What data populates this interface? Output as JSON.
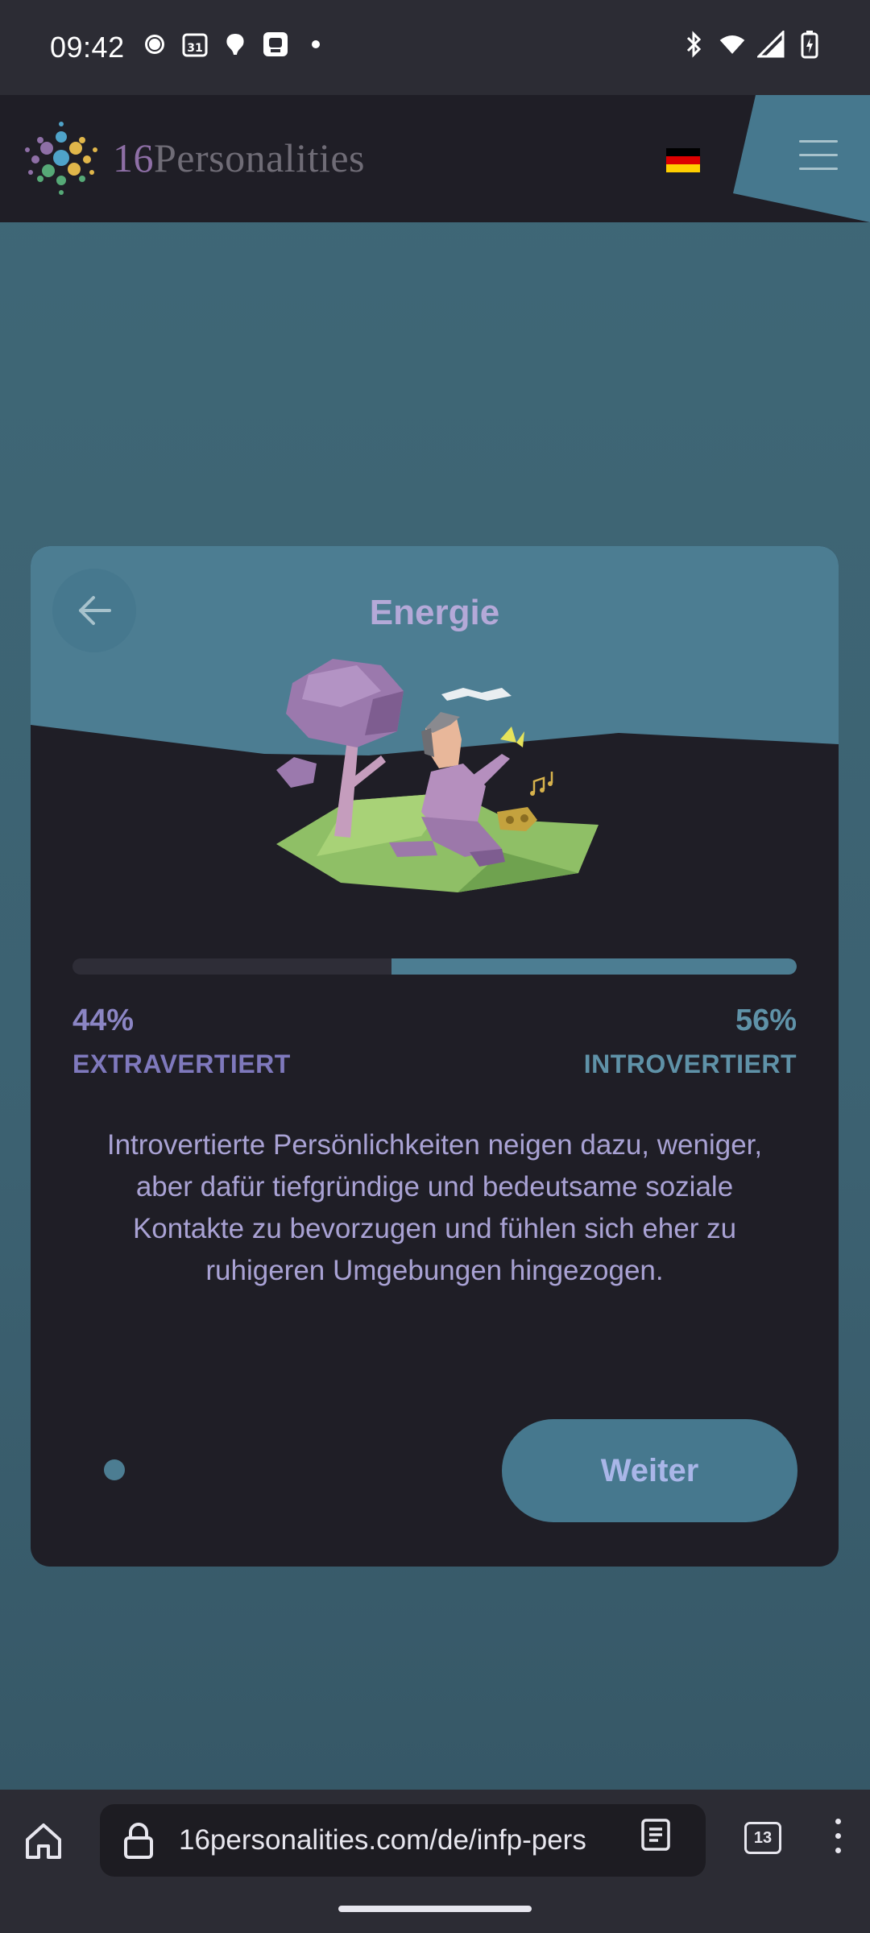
{
  "status_bar": {
    "time": "09:42",
    "left_icons": [
      "signal-messenger-icon",
      "calendar-icon",
      "notification-icon",
      "app-icon",
      "dot-icon"
    ],
    "calendar_day": "31",
    "right_icons": [
      "bluetooth-icon",
      "wifi-icon",
      "cell-signal-icon",
      "battery-icon"
    ]
  },
  "header": {
    "logo_number": "16",
    "logo_word": "Personalities",
    "language_flag": "de",
    "menu_icon": "hamburger-icon"
  },
  "card": {
    "title": "Energie",
    "back_icon": "arrow-left-icon",
    "progress": {
      "introvert_fraction": 0.56
    },
    "left": {
      "percent": "44%",
      "label": "EXTRAVERTIERT"
    },
    "right": {
      "percent": "56%",
      "label": "INTROVERTIERT"
    },
    "description": "Introvertierte Persönlichkeiten neigen dazu, weniger, aber dafür tiefgründige und bedeutsame soziale Kontakte zu bevorzugen und fühlen sich eher zu ruhigeren Umgebungen hingezogen.",
    "next_label": "Weiter"
  },
  "browser": {
    "url": "16personalities.com/de/infp-pers",
    "tab_count": "13"
  },
  "colors": {
    "page_bg": "#3f6877",
    "card_bg": "#1f1e26",
    "accent": "#46788e",
    "title": "#b4a9d8"
  }
}
